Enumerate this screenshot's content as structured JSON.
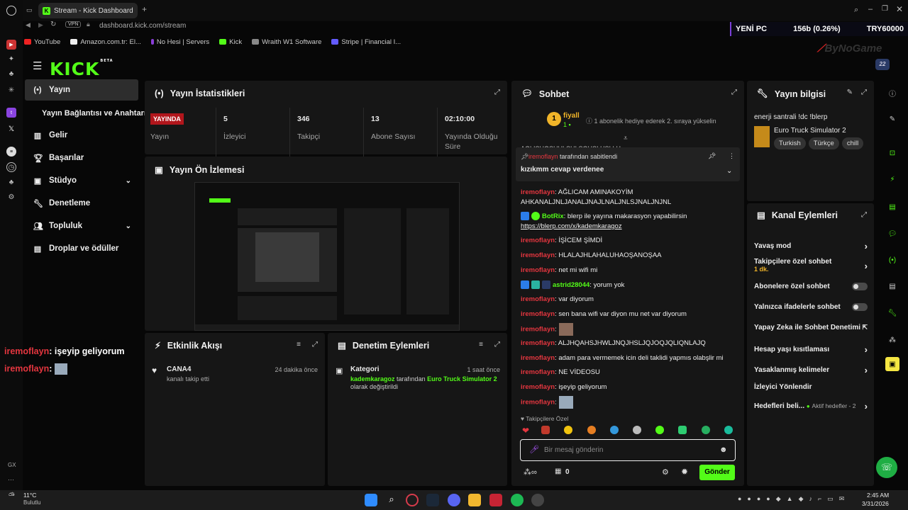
{
  "browser": {
    "tab_title": "Stream - Kick Dashboard",
    "url": "dashboard.kick.com/stream",
    "vpn": "VPN",
    "bookmarks": [
      "YouTube",
      "Amazon.com.tr: El...",
      "No Hesi | Servers",
      "Kick",
      "Wraith W1 Software",
      "Stripe | Financial I..."
    ]
  },
  "overlay": {
    "ticker_left": "YENİ PC",
    "ticker_mid": "156b (0.26%)",
    "ticker_right": "TRY60000",
    "brand": "ByNoGame"
  },
  "app": {
    "logo": "KICK",
    "logo_badge": "BETA"
  },
  "nav": [
    {
      "label": "Yayın"
    },
    {
      "label": "Yayın Bağlantısı ve Anahtarı"
    },
    {
      "label": "Gelir"
    },
    {
      "label": "Başarılar"
    },
    {
      "label": "Stüdyo"
    },
    {
      "label": "Denetleme"
    },
    {
      "label": "Topluluk"
    },
    {
      "label": "Droplar ve ödüller"
    }
  ],
  "stats": {
    "title": "Yayın İstatistikleri",
    "status_badge": "YAYINDA",
    "status_label": "Yayın",
    "items": [
      {
        "value": "5",
        "label": "İzleyici"
      },
      {
        "value": "346",
        "label": "Takipçi"
      },
      {
        "value": "13",
        "label": "Abone Sayısı"
      },
      {
        "value": "02:10:00",
        "label": "Yayında Olduğu Süre"
      }
    ]
  },
  "preview": {
    "title": "Yayın Ön İzlemesi",
    "overlay_lines": [
      {
        "user": "iremoflayn",
        "text": ": işeyip geliyorum"
      },
      {
        "user": "iremoflayn",
        "text": ":"
      }
    ]
  },
  "activity": {
    "title": "Etkinlik Akışı",
    "items": [
      {
        "name": "CANA4",
        "desc": "kanalı takip etti",
        "time": "24 dakika önce"
      }
    ]
  },
  "moderation": {
    "title": "Denetim Eylemleri",
    "items": [
      {
        "title": "Kategori",
        "time": "1 saat önce",
        "actor": "kademkaragoz",
        "mid": "tarafından",
        "target": "Euro Truck Simulator 2",
        "suffix": "olarak değiştirildi"
      }
    ]
  },
  "chat": {
    "title": "Sohbet",
    "sub_user": "fiyall",
    "sub_count": "1",
    "sub_text": "1 abonelik hediye ederek 2. sıraya yükselin",
    "cut_text": "AGLISHOSHULSHI SOHSI HSI LH",
    "pinned_by": "iremoflayn",
    "pinned_suffix": "tarafından sabitlendi",
    "pinned_text": "kızıkmm cevap verdenee",
    "messages": [
      {
        "user": "iremoflayn",
        "text": ": AĞLICAM AMINAKOYİM AHKANALJNLJANALJNAJLNALJNLSJNALJNJNL",
        "color": "#e5363f"
      },
      {
        "user": "BotRix",
        "text": ": blerp ile yayına makarasyon yapabilirsin",
        "link": "https://blerp.com/x/kademkaragoz",
        "color": "#53fc18"
      },
      {
        "user": "iremoflayn",
        "text": ": İŞİCEM ŞİMDİ",
        "color": "#e5363f"
      },
      {
        "user": "iremoflayn",
        "text": ": HLALAJHLAHALUHAOŞANOŞAA",
        "color": "#e5363f"
      },
      {
        "user": "iremoflayn",
        "text": ": net mi wifi mi",
        "color": "#e5363f"
      },
      {
        "user": "astrid28044",
        "text": ": yorum yok",
        "color": "#53fc18"
      },
      {
        "user": "iremoflayn",
        "text": ": var diyorum",
        "color": "#e5363f"
      },
      {
        "user": "iremoflayn",
        "text": ": sen bana wifi var diyon mu net var diyorum",
        "color": "#e5363f"
      },
      {
        "user": "iremoflayn",
        "text": ":",
        "color": "#e5363f"
      },
      {
        "user": "iremoflayn",
        "text": ": ALJHQAHSJHWLJNQJHSLJQJOQJQLIQNLAJQ",
        "color": "#e5363f"
      },
      {
        "user": "iremoflayn",
        "text": ": adam para vermemek icin deli taklidi yapmıs olabşlir mi",
        "color": "#e5363f"
      },
      {
        "user": "iremoflayn",
        "text": ": NE VİDEOSU",
        "color": "#e5363f"
      },
      {
        "user": "iremoflayn",
        "text": ": işeyip geliyorum",
        "color": "#e5363f"
      },
      {
        "user": "iremoflayn",
        "text": ":",
        "color": "#e5363f"
      }
    ],
    "followers_only": "Takipçilere Özel",
    "placeholder": "Bir mesaj gönderin",
    "points": "0",
    "send": "Gönder"
  },
  "stream_info": {
    "title": "Yayın bilgisi",
    "stream_title": "enerji santrali !dc !blerp",
    "game": "Euro Truck Simulator 2",
    "tags": [
      "Turkish",
      "Türkçe",
      "chill"
    ]
  },
  "channel_actions": {
    "title": "Kanal Eylemleri",
    "items": [
      {
        "label": "Yavaş mod"
      },
      {
        "label": "Takipçilere özel sohbet",
        "sub": "1 dk."
      },
      {
        "label": "Abonelere özel sohbet"
      },
      {
        "label": "Yalnızca ifadelerle sohbet"
      },
      {
        "label": "Yapay Zeka ile Sohbet Denetimi"
      },
      {
        "label": "Hesap yaşı kısıtlaması"
      },
      {
        "label": "Yasaklanmış kelimeler"
      },
      {
        "label": "İzleyici Yönlendir"
      },
      {
        "label": "Hedefleri beli...",
        "sub": "Aktif hedefler - 2"
      }
    ]
  },
  "taskbar": {
    "temp": "11°C",
    "weather": "Bulutlu",
    "time": "2:45 AM",
    "date": "3/31/2026",
    "gx": "GX"
  }
}
